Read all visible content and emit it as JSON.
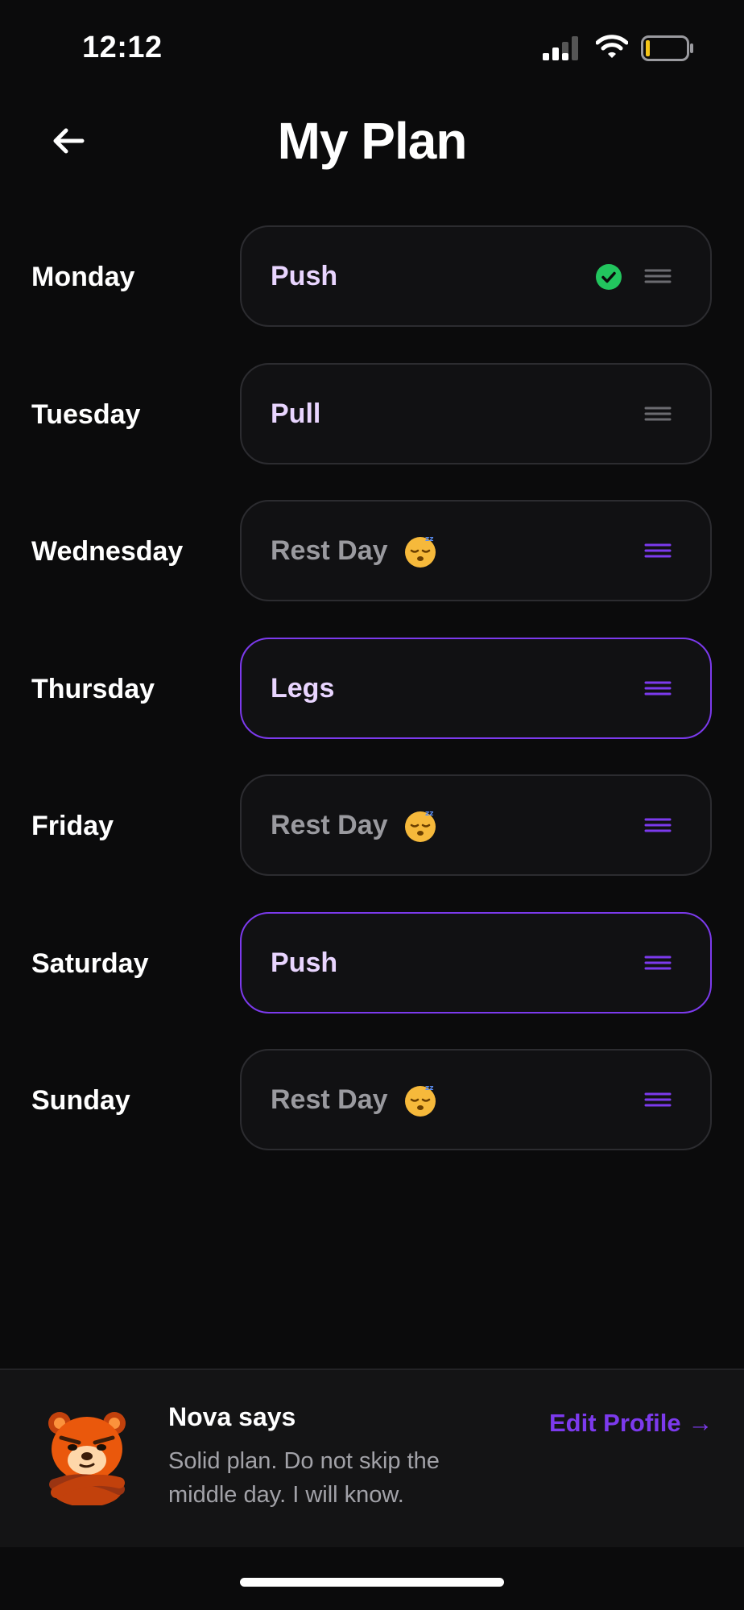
{
  "status_bar": {
    "time": "12:12",
    "signal_icon": "cellular-signal-icon",
    "wifi_icon": "wifi-icon",
    "battery_icon": "battery-low-icon"
  },
  "header": {
    "title": "My Plan",
    "back_icon": "arrow-left-icon"
  },
  "plan": [
    {
      "day": "Monday",
      "workout": "Push",
      "rest": false,
      "completed": true,
      "highlighted": false
    },
    {
      "day": "Tuesday",
      "workout": "Pull",
      "rest": false,
      "completed": false,
      "highlighted": false
    },
    {
      "day": "Wednesday",
      "workout": "Rest Day",
      "rest": true,
      "emoji": "sleeping-face-emoji",
      "completed": false,
      "highlighted": false
    },
    {
      "day": "Thursday",
      "workout": "Legs",
      "rest": false,
      "completed": false,
      "highlighted": true
    },
    {
      "day": "Friday",
      "workout": "Rest Day",
      "rest": true,
      "emoji": "sleeping-face-emoji",
      "completed": false,
      "highlighted": false
    },
    {
      "day": "Saturday",
      "workout": "Push",
      "rest": false,
      "completed": false,
      "highlighted": true
    },
    {
      "day": "Sunday",
      "workout": "Rest Day",
      "rest": true,
      "emoji": "sleeping-face-emoji",
      "completed": false,
      "highlighted": false
    }
  ],
  "footer": {
    "mascot_icon": "bear-mascot-avatar",
    "title": "Nova says",
    "message": "Solid plan. Do not skip the middle day. I will know.",
    "edit_link": "Edit Profile →"
  },
  "colors": {
    "background": "#0b0b0c",
    "card_background": "#111113",
    "card_border": "#2c2c30",
    "accent": "#7c3aed",
    "workout_text": "#e9d5ff",
    "rest_text": "#9a9a9f",
    "check_green": "#22c55e",
    "handle_inactive": "#6b6b70"
  }
}
